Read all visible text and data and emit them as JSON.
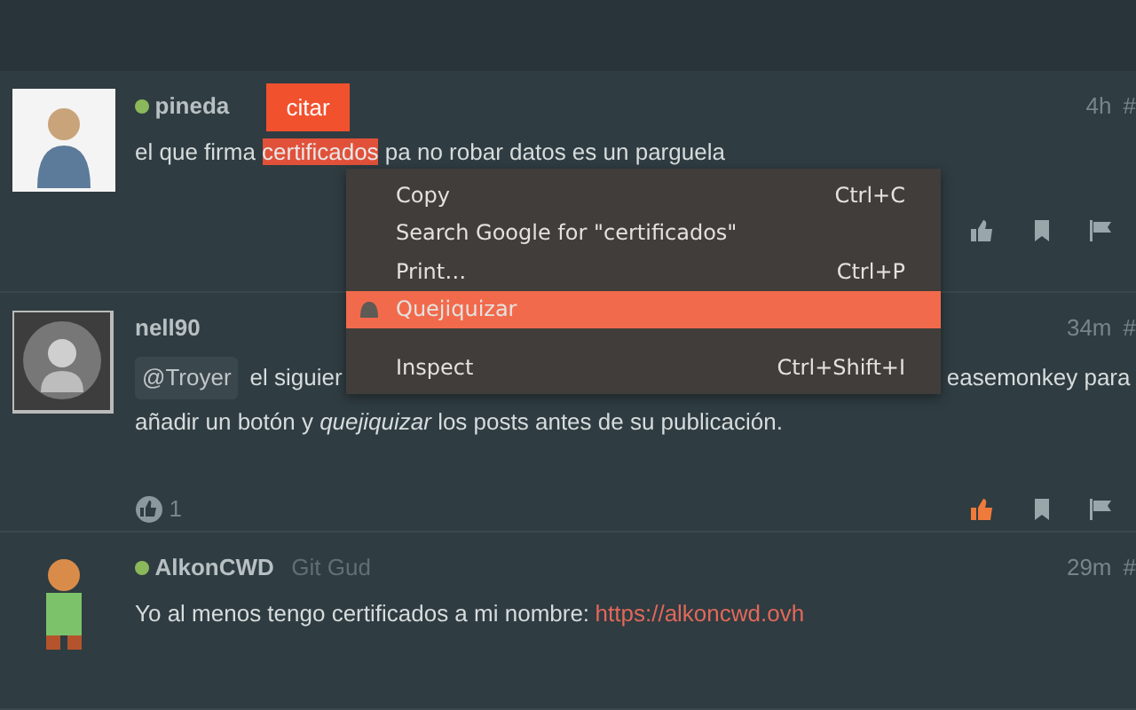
{
  "posts": [
    {
      "user": "pineda",
      "online": true,
      "time": "4h",
      "number": "#",
      "text_before": "el que firma ",
      "selection": "certificados",
      "text_after": " pa no robar datos es un parguela",
      "selected_text": true,
      "liked": false
    },
    {
      "user": "nell90",
      "online": false,
      "time": "34m",
      "number": "#",
      "mention": "@Troyer",
      "line_start": "el siguier",
      "line_end": "easemonkey para",
      "line2": "añadir un botón y *quejiquizar* los posts antes de su publicación.",
      "liked": true,
      "likes": "1"
    },
    {
      "user": "AlkonCWD",
      "online": true,
      "title": "Git Gud",
      "time": "29m",
      "number": "#",
      "text": "Yo al menos tengo certificados a mi nombre: ",
      "link": "https://alkoncwd.ovh"
    }
  ],
  "quote_button": "citar",
  "context_menu": [
    {
      "kind": "item",
      "label": "Copy",
      "shortcut": "Ctrl+C",
      "selected": false
    },
    {
      "kind": "item",
      "label": "Search Google for \"certificados\"",
      "selected": false
    },
    {
      "kind": "item",
      "label": "Print…",
      "shortcut": "Ctrl+P",
      "selected": false
    },
    {
      "kind": "extension",
      "label": "Quejiquizar",
      "selected": true
    },
    {
      "kind": "separator"
    },
    {
      "kind": "item",
      "label": "Inspect",
      "shortcut": "Ctrl+Shift+I",
      "selected": false
    }
  ]
}
